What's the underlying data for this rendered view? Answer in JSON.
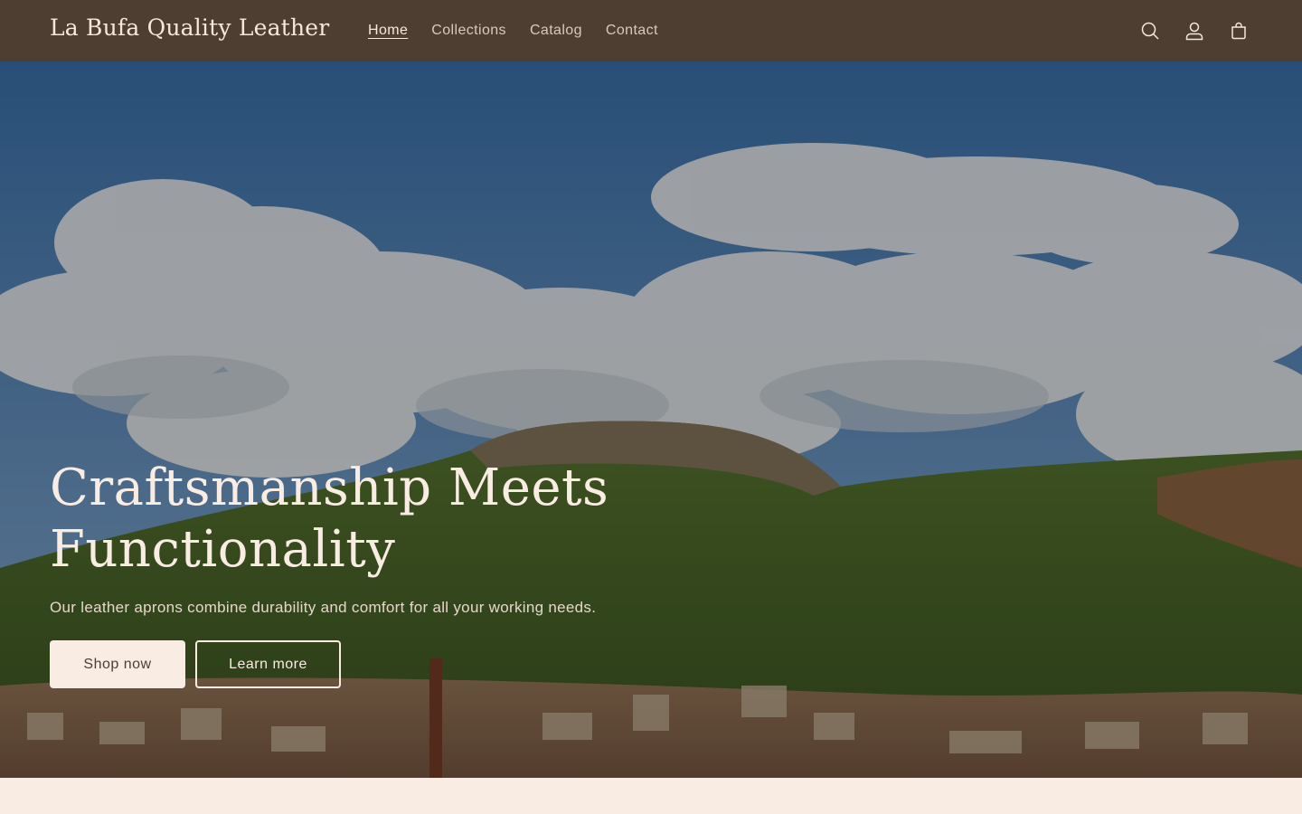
{
  "header": {
    "logo": "La Bufa Quality Leather",
    "nav": [
      {
        "label": "Home",
        "active": true
      },
      {
        "label": "Collections",
        "active": false
      },
      {
        "label": "Catalog",
        "active": false
      },
      {
        "label": "Contact",
        "active": false
      }
    ],
    "icons": [
      "search-icon",
      "account-icon",
      "cart-icon"
    ]
  },
  "hero": {
    "title_line1": "Craftsmanship Meets",
    "title_line2": "Functionality",
    "subtitle": "Our leather aprons combine durability and comfort for all your working needs.",
    "primary_button": "Shop now",
    "secondary_button": "Learn more"
  },
  "colors": {
    "header_bg": "#4d3e31",
    "page_bg": "#f8ece3",
    "text_light": "#f6e7dc"
  }
}
